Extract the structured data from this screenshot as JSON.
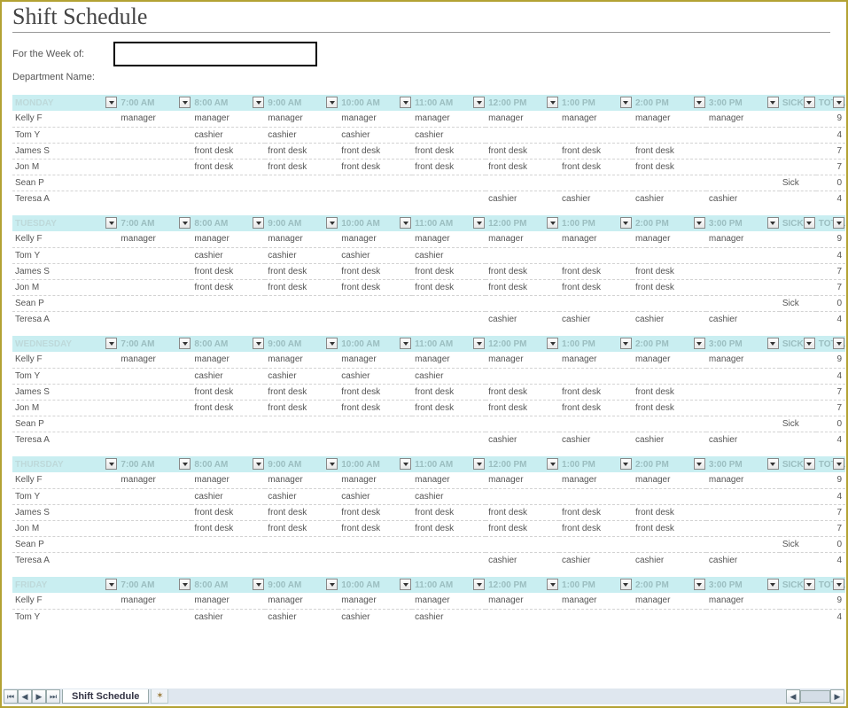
{
  "title": "Shift Schedule",
  "week_label": "For the Week of:",
  "week_value": "",
  "dept_label": "Department Name:",
  "tab_name": "Shift Schedule",
  "time_headers": [
    "7:00 AM",
    "8:00 AM",
    "9:00 AM",
    "10:00 AM",
    "11:00 AM",
    "12:00 PM",
    "1:00 PM",
    "2:00 PM",
    "3:00 PM"
  ],
  "sick_header": "SICK?",
  "total_header": "TOTAL",
  "days": [
    {
      "name": "MONDAY",
      "rows": [
        {
          "name": "Kelly F",
          "cells": [
            "manager",
            "manager",
            "manager",
            "manager",
            "manager",
            "manager",
            "manager",
            "manager",
            "manager"
          ],
          "sick": "",
          "total": "9"
        },
        {
          "name": "Tom Y",
          "cells": [
            "",
            "cashier",
            "cashier",
            "cashier",
            "cashier",
            "",
            "",
            "",
            ""
          ],
          "sick": "",
          "total": "4"
        },
        {
          "name": "James S",
          "cells": [
            "",
            "front desk",
            "front desk",
            "front desk",
            "front desk",
            "front desk",
            "front desk",
            "front desk",
            ""
          ],
          "sick": "",
          "total": "7"
        },
        {
          "name": "Jon M",
          "cells": [
            "",
            "front desk",
            "front desk",
            "front desk",
            "front desk",
            "front desk",
            "front desk",
            "front desk",
            ""
          ],
          "sick": "",
          "total": "7"
        },
        {
          "name": "Sean P",
          "cells": [
            "",
            "",
            "",
            "",
            "",
            "",
            "",
            "",
            ""
          ],
          "sick": "Sick",
          "total": "0"
        },
        {
          "name": "Teresa A",
          "cells": [
            "",
            "",
            "",
            "",
            "",
            "cashier",
            "cashier",
            "cashier",
            "cashier"
          ],
          "sick": "",
          "total": "4"
        }
      ]
    },
    {
      "name": "TUESDAY",
      "rows": [
        {
          "name": "Kelly F",
          "cells": [
            "manager",
            "manager",
            "manager",
            "manager",
            "manager",
            "manager",
            "manager",
            "manager",
            "manager"
          ],
          "sick": "",
          "total": "9"
        },
        {
          "name": "Tom Y",
          "cells": [
            "",
            "cashier",
            "cashier",
            "cashier",
            "cashier",
            "",
            "",
            "",
            ""
          ],
          "sick": "",
          "total": "4"
        },
        {
          "name": "James S",
          "cells": [
            "",
            "front desk",
            "front desk",
            "front desk",
            "front desk",
            "front desk",
            "front desk",
            "front desk",
            ""
          ],
          "sick": "",
          "total": "7"
        },
        {
          "name": "Jon M",
          "cells": [
            "",
            "front desk",
            "front desk",
            "front desk",
            "front desk",
            "front desk",
            "front desk",
            "front desk",
            ""
          ],
          "sick": "",
          "total": "7"
        },
        {
          "name": "Sean P",
          "cells": [
            "",
            "",
            "",
            "",
            "",
            "",
            "",
            "",
            ""
          ],
          "sick": "Sick",
          "total": "0"
        },
        {
          "name": "Teresa A",
          "cells": [
            "",
            "",
            "",
            "",
            "",
            "cashier",
            "cashier",
            "cashier",
            "cashier"
          ],
          "sick": "",
          "total": "4"
        }
      ]
    },
    {
      "name": "WEDNESDAY",
      "rows": [
        {
          "name": "Kelly F",
          "cells": [
            "manager",
            "manager",
            "manager",
            "manager",
            "manager",
            "manager",
            "manager",
            "manager",
            "manager"
          ],
          "sick": "",
          "total": "9"
        },
        {
          "name": "Tom Y",
          "cells": [
            "",
            "cashier",
            "cashier",
            "cashier",
            "cashier",
            "",
            "",
            "",
            ""
          ],
          "sick": "",
          "total": "4"
        },
        {
          "name": "James S",
          "cells": [
            "",
            "front desk",
            "front desk",
            "front desk",
            "front desk",
            "front desk",
            "front desk",
            "front desk",
            ""
          ],
          "sick": "",
          "total": "7"
        },
        {
          "name": "Jon M",
          "cells": [
            "",
            "front desk",
            "front desk",
            "front desk",
            "front desk",
            "front desk",
            "front desk",
            "front desk",
            ""
          ],
          "sick": "",
          "total": "7"
        },
        {
          "name": "Sean P",
          "cells": [
            "",
            "",
            "",
            "",
            "",
            "",
            "",
            "",
            ""
          ],
          "sick": "Sick",
          "total": "0"
        },
        {
          "name": "Teresa A",
          "cells": [
            "",
            "",
            "",
            "",
            "",
            "cashier",
            "cashier",
            "cashier",
            "cashier"
          ],
          "sick": "",
          "total": "4"
        }
      ]
    },
    {
      "name": "THURSDAY",
      "rows": [
        {
          "name": "Kelly F",
          "cells": [
            "manager",
            "manager",
            "manager",
            "manager",
            "manager",
            "manager",
            "manager",
            "manager",
            "manager"
          ],
          "sick": "",
          "total": "9"
        },
        {
          "name": "Tom Y",
          "cells": [
            "",
            "cashier",
            "cashier",
            "cashier",
            "cashier",
            "",
            "",
            "",
            ""
          ],
          "sick": "",
          "total": "4"
        },
        {
          "name": "James S",
          "cells": [
            "",
            "front desk",
            "front desk",
            "front desk",
            "front desk",
            "front desk",
            "front desk",
            "front desk",
            ""
          ],
          "sick": "",
          "total": "7"
        },
        {
          "name": "Jon M",
          "cells": [
            "",
            "front desk",
            "front desk",
            "front desk",
            "front desk",
            "front desk",
            "front desk",
            "front desk",
            ""
          ],
          "sick": "",
          "total": "7"
        },
        {
          "name": "Sean P",
          "cells": [
            "",
            "",
            "",
            "",
            "",
            "",
            "",
            "",
            ""
          ],
          "sick": "Sick",
          "total": "0"
        },
        {
          "name": "Teresa A",
          "cells": [
            "",
            "",
            "",
            "",
            "",
            "cashier",
            "cashier",
            "cashier",
            "cashier"
          ],
          "sick": "",
          "total": "4"
        }
      ]
    },
    {
      "name": "FRIDAY",
      "rows": [
        {
          "name": "Kelly F",
          "cells": [
            "manager",
            "manager",
            "manager",
            "manager",
            "manager",
            "manager",
            "manager",
            "manager",
            "manager"
          ],
          "sick": "",
          "total": "9"
        },
        {
          "name": "Tom Y",
          "cells": [
            "",
            "cashier",
            "cashier",
            "cashier",
            "cashier",
            "",
            "",
            "",
            ""
          ],
          "sick": "",
          "total": "4"
        }
      ]
    }
  ]
}
